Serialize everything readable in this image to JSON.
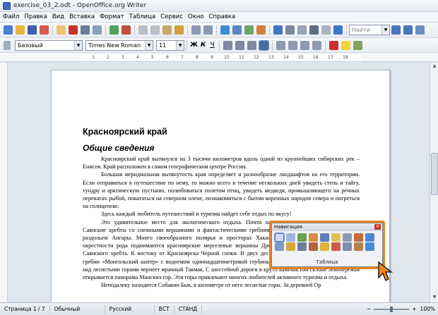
{
  "window": {
    "title": "exercise_03_2.odt - OpenOffice.org Writer"
  },
  "menu": [
    "Файл",
    "Правка",
    "Вид",
    "Вставка",
    "Формат",
    "Таблица",
    "Сервис",
    "Окно",
    "Справка"
  ],
  "toolbar": {
    "find_placeholder": "Найти"
  },
  "format": {
    "style": "Базовый",
    "font": "Times New Roman",
    "size": "11"
  },
  "ruler": {
    "ticks": [
      "1",
      "2",
      "3",
      "4",
      "5",
      "6",
      "7",
      "8",
      "9",
      "10",
      "11",
      "12",
      "13",
      "14",
      "15",
      "16",
      "17",
      "18"
    ]
  },
  "document": {
    "title": "Красноярский край",
    "subtitle": "Общие сведения",
    "paragraphs": [
      "Красноярский край вытянулся на 3 тысячи километров вдоль одной из крупнейших сибирских рек – Енисея. Край расположен в самом географическом центре России.",
      "Большая меридиальная вытянутость края определяет и разнообразие ландшафтов на его территории. Если отправиться в путешествие по нему, то можно всего в течение нескольких дней увидеть степь и тайгу, тундру и арктическую пустыню, полюбоваться полетом птиц, увидеть медведя, промышляющего на речных перекатах рыбой, покататься на северном олене, познакомиться с бытом коренных народов севера и погреться на солнцепеке.",
      "Здесь каждый любитель путешествий и туризма найдет себе отдых по вкусу!",
      "Это удивительное место для экологического отдыха. Почти на тысячу километров протянулись Саянские хребты со снежными вершинами и фантастическими гребнями. Буйбинских ущелий, величавым раздольем Ангары. Много своеобразного полярья и просторах Хакасских степей. Ярки и живописны окрестности рода поднимаются красноярские мергелевые вершины Дроканских и Енисея тянутся отроги Саянского хребта. К востоку от Красноярска Черной сопки. В двух десятках километров от нее находятся гребни «Монгольский шатер» с водоемом одиннадцатиметровой глубины на вершине. Юго-западнее города над лесистыми горами чернеет мрачный Такмак. С шоссейной дороги в круто каменистом склоне левобережья открывается панорама Манских гор. Эти горы привлекают многих любителей активного туризма и отдыха.",
      "Неподалеку находится Собакин Бык, в километре от него лесистые горы. За деревней Ор"
    ]
  },
  "navigator": {
    "title": "Навигация",
    "label": "Таблица"
  },
  "status": {
    "page": "Страница 1 / 7",
    "style": "Обычный",
    "lang": "Русский",
    "ins": "ВСТ",
    "std": "СТАНД",
    "zoom": "100%"
  }
}
